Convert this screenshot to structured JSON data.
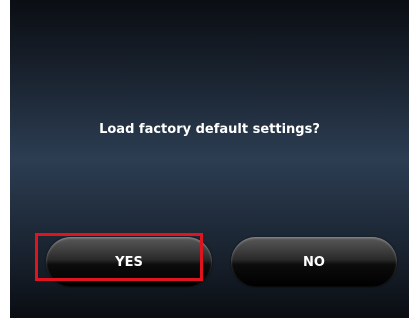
{
  "dialog": {
    "message": "Load factory default settings?",
    "yes_label": "YES",
    "no_label": "NO"
  },
  "colors": {
    "highlight": "#e0141e",
    "text": "#ffffff"
  }
}
